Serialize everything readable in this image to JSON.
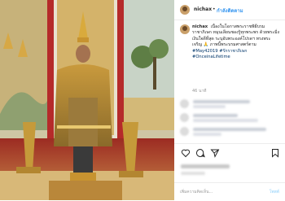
{
  "header": {
    "username": "nichax",
    "separator": "•",
    "follow_label": "กำลังติดตาม"
  },
  "caption": {
    "username": "nichax",
    "text": "เนื่องในโอกาสพระราชพิธีบรมราชาภิเษก หมุนเลียนชองรู้ทุกพระพร ด้วยพระมิ่งเงินใจดีที่สุด ระบุอับพระองค์โปรดฯ ทรงพระเจริญ 🙏 ภาพนี้พระบรมศาสตร์ตาม",
    "tags": "#May42019 #รักราชาภิเษก #OnceinaLifetime"
  },
  "timestamp": "46 นาที",
  "comment_placeholder": "เพิ่มความคิดเห็น...",
  "post_label": "โพสต์",
  "icons": [
    "heart-icon",
    "comment-icon",
    "share-icon",
    "bookmark-icon"
  ],
  "colors": {
    "link": "#3897f0",
    "text": "#262626"
  }
}
